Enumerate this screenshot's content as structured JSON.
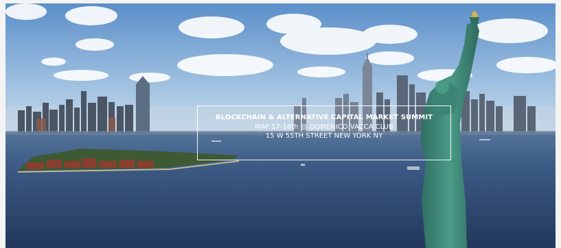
{
  "banner": {
    "title": "BLOCKCHAIN & ALTERNATIVE  CAPITAL MARKET SUMMIT",
    "date_venue": "MAY 17-18th @ DOMENICO VACCA CLUB",
    "address": "15 W 55TH STREET NEW YORK NY"
  },
  "colors": {
    "sky": "#6f9fd0",
    "water": "#2f4f7a",
    "statue": "#3f8a7a",
    "text": "#ffffff"
  }
}
